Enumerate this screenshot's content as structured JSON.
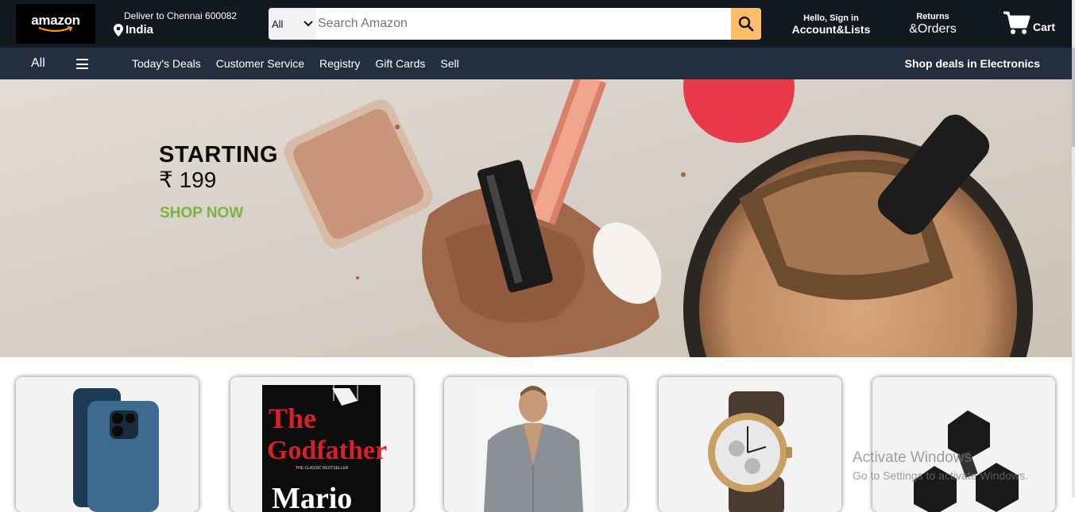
{
  "header": {
    "logo_text": "amazon",
    "deliver_to": "Deliver to Chennai 600082",
    "country": "India",
    "search_category": "All",
    "search_placeholder": "Search Amazon",
    "account_greeting": "Hello, Sign in",
    "account_label": "Account&Lists",
    "returns_label": "Returns",
    "orders_label": "&Orders",
    "cart_label": "Cart"
  },
  "nav": {
    "all_label": "All",
    "links": [
      "Today's Deals",
      "Customer Service",
      "Registry",
      "Gift Cards",
      "Sell"
    ],
    "promo": "Shop deals in Electronics"
  },
  "banner": {
    "title": "STARTING",
    "price": "₹ 199",
    "cta": "SHOP NOW"
  },
  "cards": [
    {
      "name": "iPhone"
    },
    {
      "name": "The Godfather book",
      "book_title_line1": "The",
      "book_title_line2": "Godfather",
      "book_tagline": "THE CLASSIC BESTSELLER",
      "book_author": "Mario"
    },
    {
      "name": "Grey shirt"
    },
    {
      "name": "Smart watch"
    },
    {
      "name": "Dumbbells"
    }
  ],
  "watermark": {
    "line1": "Activate Windows",
    "line2": "Go to Settings to activate Windows."
  },
  "colors": {
    "topbar": "#131921",
    "navbar": "#232f3e",
    "search_button": "#febd69",
    "shop_now": "#7cb342"
  }
}
